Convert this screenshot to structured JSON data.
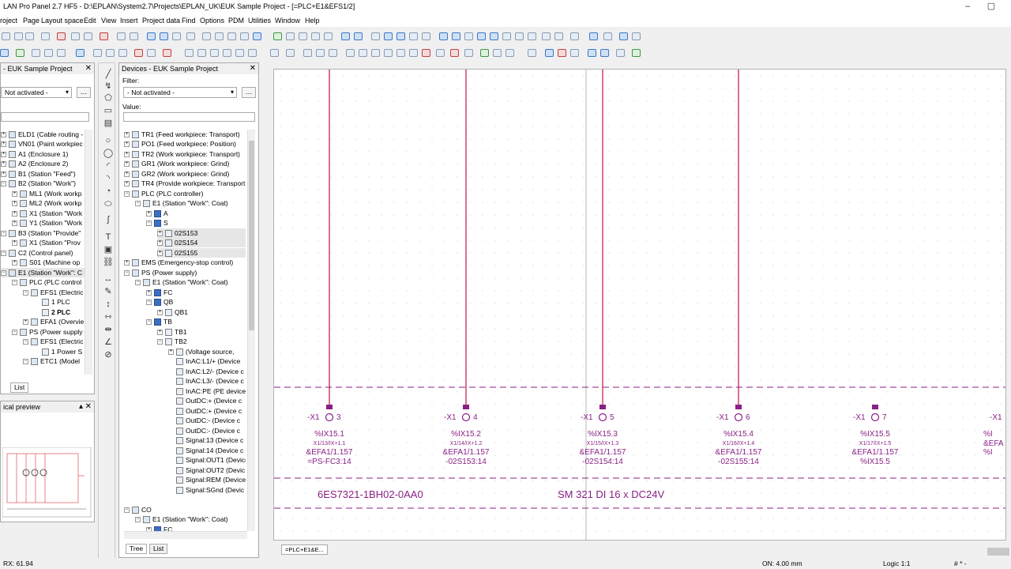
{
  "window": {
    "title": "LAN Pro Panel 2.7 HF5 - D:\\EPLAN\\System2.7\\Projects\\EPLAN_UK\\EUK Sample Project - [=PLC+E1&EFS1/2]",
    "minimize": "–",
    "maximize": "▢"
  },
  "menu": [
    "roject",
    "Page",
    "Layout space",
    "Edit",
    "View",
    "Insert",
    "Project data",
    "Find",
    "Options",
    "PDM",
    "Utilities",
    "Window",
    "Help"
  ],
  "nav": {
    "title": "- EUK Sample Project",
    "filter_value": "Not activated -",
    "tab_list": "List",
    "items": [
      "ELD1 (Cable routing -",
      "VN01 (Paint workpiec",
      "A1 (Enclosure 1)",
      "A2 (Enclosure 2)",
      "B1 (Station \"Feed\")",
      "B2 (Station \"Work\")",
      "ML1 (Work workp",
      "ML2 (Work workp",
      "X1 (Station \"Work",
      "Y1 (Station \"Work",
      "B3 (Station \"Provide\"",
      "X1 (Station \"Prov",
      "C2 (Control panel)",
      "S01 (Machine op",
      "E1 (Station \"Work\": C",
      "PLC (PLC control",
      "EFS1 (Electric",
      "1 PLC",
      "2 PLC",
      "EFA1 (Overvie",
      "PS (Power supply",
      "EFS1 (Electric",
      "1 Power S",
      "ETC1 (Model"
    ]
  },
  "devices": {
    "title": "Devices - EUK Sample Project",
    "filter_label": "Filter:",
    "filter_value": "- Not activated -",
    "value_label": "Value:",
    "tab_tree": "Tree",
    "tab_list": "List",
    "items": [
      "TR1 (Feed workpiece: Transport)",
      "PO1 (Feed workpiece: Position)",
      "TR2 (Work workpiece: Transport)",
      "GR1 (Work workpiece: Grind)",
      "GR2 (Work workpiece: Grind)",
      "TR4 (Provide workpiece: Transport",
      "PLC (PLC controller)",
      "E1 (Station \"Work\": Coat)",
      "A",
      "S",
      "02S153",
      "02S154",
      "02S155",
      "EMS (Emergency-stop control)",
      "PS (Power supply)",
      "E1 (Station \"Work\": Coat)",
      "FC",
      "QB",
      "QB1",
      "TB",
      "TB1",
      "TB2",
      "(Voltage source,",
      "InAC:L1/+ (Device",
      "InAC:L2/- (Device c",
      "InAC:L3/- (Device c",
      "InAC:PE (PE device",
      "OutDC:+ (Device c",
      "OutDC:+ (Device c",
      "OutDC:- (Device c",
      "OutDC:- (Device c",
      "Signal:13 (Device c",
      "Signal:14 (Device c",
      "Signal:OUT1 (Device",
      "Signal:OUT2 (Devic",
      "Signal:REM (Device",
      "Signal:SGnd (Devic",
      "CO",
      "E1 (Station \"Work\": Coat)",
      "FC"
    ]
  },
  "preview": {
    "title": "ical preview"
  },
  "schematic": {
    "terminals": [
      {
        "ref": "-X1",
        "num": "3",
        "addr": "%IX15.1",
        "sub": "X1/13/IX+1.1",
        "link": "&EFA1/1.157",
        "dev": "=PS-FC3:14"
      },
      {
        "ref": "-X1",
        "num": "4",
        "addr": "%IX15.2",
        "sub": "X1/14/IX+1.2",
        "link": "&EFA1/1.157",
        "dev": "-02S153:14"
      },
      {
        "ref": "-X1",
        "num": "5",
        "addr": "%IX15.3",
        "sub": "X1/15/IX+1.3",
        "link": "&EFA1/1.157",
        "dev": "-02S154:14"
      },
      {
        "ref": "-X1",
        "num": "6",
        "addr": "%IX15.4",
        "sub": "X1/16/IX+1.4",
        "link": "&EFA1/1.157",
        "dev": "-02S155:14"
      },
      {
        "ref": "-X1",
        "num": "7",
        "addr": "%IX15.5",
        "sub": "X1/17/IX+1.5",
        "link": "&EFA1/1.157",
        "dev": "%IX15.5"
      },
      {
        "ref": "-X1",
        "num": "",
        "addr": "%I",
        "sub": "",
        "link": "&EFA",
        "dev": "%I"
      }
    ],
    "part_number": "6ES7321-1BH02-0AA0",
    "module_desc": "SM 321 DI 16 x DC24V",
    "page_tab": "=PLC+E1&E..."
  },
  "status": {
    "coords": "RX: 61.94",
    "grid": "ON: 4.00 mm",
    "logic": "Logic 1:1",
    "misc": "# * -"
  },
  "colors": {
    "accent": "#8a1f86",
    "wire": "#c0143c"
  }
}
